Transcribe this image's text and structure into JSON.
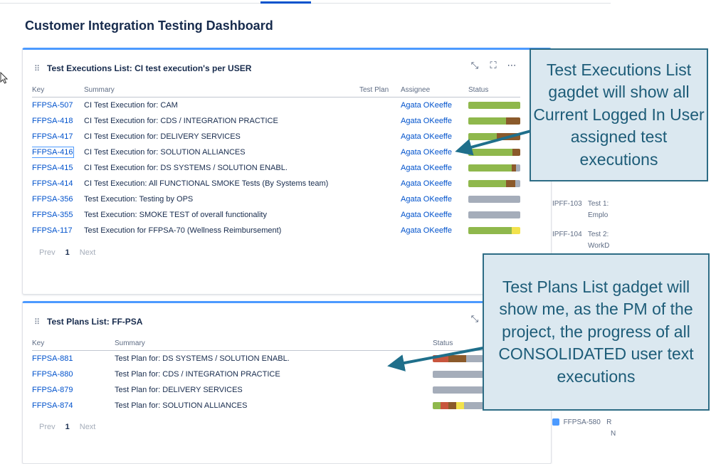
{
  "page": {
    "title": "Customer Integration Testing Dashboard"
  },
  "executions_gadget": {
    "title": "Test Executions List: CI test execution's per USER",
    "columns": [
      "Key",
      "Summary",
      "Test Plan",
      "Assignee",
      "Status"
    ],
    "rows": [
      {
        "key": "FFPSA-507",
        "summary": "CI Test Execution for: CAM",
        "test_plan": "",
        "assignee": "Agata OKeeffe",
        "status": [
          {
            "color": "#8fb84c",
            "pct": 100
          }
        ]
      },
      {
        "key": "FFPSA-418",
        "summary": "CI Test Execution for: CDS / INTEGRATION PRACTICE",
        "test_plan": "",
        "assignee": "Agata OKeeffe",
        "status": [
          {
            "color": "#8fb84c",
            "pct": 72
          },
          {
            "color": "#8b5a2b",
            "pct": 28
          }
        ]
      },
      {
        "key": "FFPSA-417",
        "summary": "CI Test Execution for: DELIVERY SERVICES",
        "test_plan": "",
        "assignee": "Agata OKeeffe",
        "status": [
          {
            "color": "#8fb84c",
            "pct": 55
          },
          {
            "color": "#8b5a2b",
            "pct": 45
          }
        ]
      },
      {
        "key": "FFPSA-416",
        "summary": "CI Test Execution for: SOLUTION ALLIANCES",
        "test_plan": "",
        "assignee": "Agata OKeeffe",
        "status": [
          {
            "color": "#8fb84c",
            "pct": 85
          },
          {
            "color": "#8b5a2b",
            "pct": 15
          }
        ]
      },
      {
        "key": "FFPSA-415",
        "summary": "CI Test Execution for: DS SYSTEMS / SOLUTION ENABL.",
        "test_plan": "",
        "assignee": "Agata OKeeffe",
        "status": [
          {
            "color": "#8fb84c",
            "pct": 84
          },
          {
            "color": "#8b5a2b",
            "pct": 8
          },
          {
            "color": "#a5adba",
            "pct": 8
          }
        ]
      },
      {
        "key": "FFPSA-414",
        "summary": "CI Test Execution: All FUNCTIONAL SMOKE Tests (By Systems team)",
        "test_plan": "",
        "assignee": "Agata OKeeffe",
        "status": [
          {
            "color": "#8fb84c",
            "pct": 72
          },
          {
            "color": "#8b5a2b",
            "pct": 18
          },
          {
            "color": "#a5adba",
            "pct": 10
          }
        ]
      },
      {
        "key": "FFPSA-356",
        "summary": "Test Execution: Testing by OPS",
        "test_plan": "",
        "assignee": "Agata OKeeffe",
        "status": [
          {
            "color": "#a5adba",
            "pct": 100
          }
        ]
      },
      {
        "key": "FFPSA-355",
        "summary": "Test Execution: SMOKE TEST of overall functionality",
        "test_plan": "",
        "assignee": "Agata OKeeffe",
        "status": [
          {
            "color": "#a5adba",
            "pct": 100
          }
        ]
      },
      {
        "key": "FFPSA-117",
        "summary": "Test Execution for FFPSA-70 (Wellness Reimbursement)",
        "test_plan": "",
        "assignee": "Agata OKeeffe",
        "status": [
          {
            "color": "#8fb84c",
            "pct": 84
          },
          {
            "color": "#f2e24c",
            "pct": 16
          }
        ]
      }
    ],
    "pager": {
      "prev": "Prev",
      "page": "1",
      "next": "Next"
    }
  },
  "plans_gadget": {
    "title": "Test Plans List: FF-PSA",
    "columns": [
      "Key",
      "Summary",
      "Status"
    ],
    "rows": [
      {
        "key": "FFPSA-881",
        "summary": "Test Plan for: DS SYSTEMS / SOLUTION ENABL.",
        "status": [
          {
            "color": "#c8553d",
            "pct": 30
          },
          {
            "color": "#8b5a2b",
            "pct": 35
          },
          {
            "color": "#a5adba",
            "pct": 35
          }
        ]
      },
      {
        "key": "FFPSA-880",
        "summary": "Test Plan for: CDS / INTEGRATION PRACTICE",
        "status": [
          {
            "color": "#a5adba",
            "pct": 100
          }
        ]
      },
      {
        "key": "FFPSA-879",
        "summary": "Test Plan for: DELIVERY SERVICES",
        "status": [
          {
            "color": "#a5adba",
            "pct": 100
          }
        ]
      },
      {
        "key": "FFPSA-874",
        "summary": "Test Plan for: SOLUTION ALLIANCES",
        "status": [
          {
            "color": "#8fb84c",
            "pct": 15
          },
          {
            "color": "#c8553d",
            "pct": 15
          },
          {
            "color": "#8b5a2b",
            "pct": 15
          },
          {
            "color": "#f2e24c",
            "pct": 15
          },
          {
            "color": "#a5adba",
            "pct": 40
          }
        ]
      }
    ],
    "pager": {
      "prev": "Prev",
      "page": "1",
      "next": "Next"
    }
  },
  "right_panel": {
    "items": [
      {
        "key": "IPFF-103",
        "text": "Test 1:",
        "sub": "Emplo"
      },
      {
        "key": "IPFF-104",
        "text": "Test 2:",
        "sub": "WorkD"
      },
      {
        "key": "FFPSA-580",
        "text": "R",
        "sub": "N"
      }
    ]
  },
  "callouts": {
    "executions": "Test Executions List gagdet will show all Current Logged In User assigned test executions",
    "plans": "Test Plans List gadget will show me, as the PM of the project, the progress of all CONSOLIDATED user text executions"
  },
  "colors": {
    "accent": "#0052cc",
    "callout_fill": "#dbe8f0",
    "callout_border": "#2d6c85",
    "arrow": "#1f6f8b"
  }
}
